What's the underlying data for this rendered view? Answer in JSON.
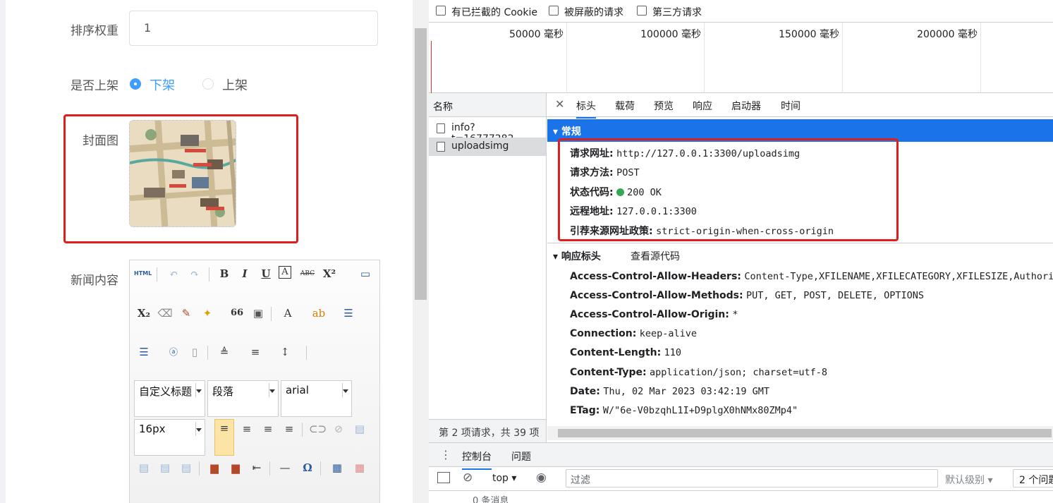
{
  "form": {
    "sort_weight_label": "排序权重",
    "sort_weight_value": "1",
    "listed_label": "是否上架",
    "listed_options": [
      "下架",
      "上架"
    ],
    "cover_label": "封面图",
    "content_label": "新闻内容",
    "editor": {
      "html_btn": "HTML",
      "custom_title_select": "自定义标题",
      "paragraph_select": "段落",
      "font_select": "arial",
      "size_select": "16px",
      "bold": "B",
      "italic": "I",
      "underline": "U",
      "font_border": "A",
      "strike": "ABC",
      "superscript": "X²",
      "subscript": "X₂",
      "quote": "66",
      "font_color": "A",
      "omega": "Ω"
    }
  },
  "devtools": {
    "filters": [
      "有已拦截的 Cookie",
      "被屏蔽的请求",
      "第三方请求"
    ],
    "timeline_ticks": [
      "50000 毫秒",
      "100000 毫秒",
      "150000 毫秒",
      "200000 毫秒"
    ],
    "name_col": "名称",
    "requests": [
      {
        "name": "info?t=16777282…",
        "selected": false
      },
      {
        "name": "uploadsimg",
        "selected": true
      }
    ],
    "footer": "第 2 项请求，共 39 项",
    "tabs": [
      "标头",
      "载荷",
      "预览",
      "响应",
      "启动器",
      "时间"
    ],
    "general_title": "常规",
    "general": [
      {
        "k": "请求网址:",
        "v": "http://127.0.0.1:3300/uploadsimg"
      },
      {
        "k": "请求方法:",
        "v": "POST"
      },
      {
        "k": "状态代码:",
        "v": "200 OK"
      },
      {
        "k": "远程地址:",
        "v": "127.0.0.1:3300"
      },
      {
        "k": "引荐来源网址政策:",
        "v": "strict-origin-when-cross-origin"
      }
    ],
    "response_headers_title": "响应标头",
    "view_source": "查看源代码",
    "response_headers": [
      {
        "k": "Access-Control-Allow-Headers:",
        "v": "Content-Type,XFILENAME,XFILECATEGORY,XFILESIZE,Authoriza"
      },
      {
        "k": "Access-Control-Allow-Methods:",
        "v": "PUT, GET, POST, DELETE, OPTIONS"
      },
      {
        "k": "Access-Control-Allow-Origin:",
        "v": "*"
      },
      {
        "k": "Connection:",
        "v": "keep-alive"
      },
      {
        "k": "Content-Length:",
        "v": "110"
      },
      {
        "k": "Content-Type:",
        "v": "application/json; charset=utf-8"
      },
      {
        "k": "Date:",
        "v": "Thu, 02 Mar 2023 03:42:19 GMT"
      },
      {
        "k": "ETag:",
        "v": "W/\"6e-V0bzqhL1I+D9plgX0hNMx80ZMp4\""
      }
    ],
    "console_tabs": [
      "控制台",
      "问题"
    ],
    "console_context": "top",
    "filter_placeholder": "过滤",
    "default_levels": "默认级别",
    "issues": "2 个问题",
    "messages_row": "0 条消息"
  },
  "colors": {
    "accent": "#1a73e8",
    "highlight_box": "#e01e1e",
    "radio_blue": "#409eff",
    "status_green": "#34a853"
  }
}
